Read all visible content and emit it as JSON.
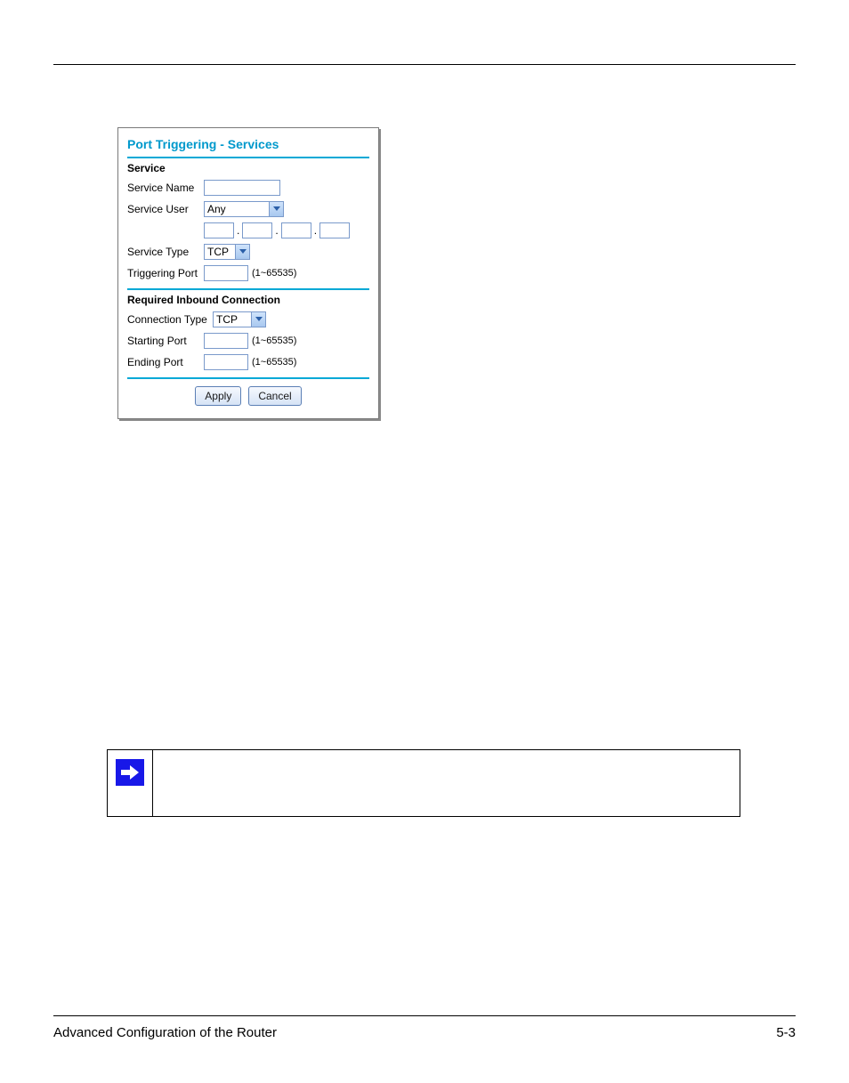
{
  "panel": {
    "title": "Port Triggering - Services",
    "service": {
      "heading": "Service",
      "name_label": "Service Name",
      "name_value": "",
      "user_label": "Service User",
      "user_value": "Any",
      "ip": {
        "o1": "",
        "o2": "",
        "o3": "",
        "o4": ""
      },
      "type_label": "Service Type",
      "type_value": "TCP",
      "trig_label": "Triggering Port",
      "trig_value": "",
      "trig_hint": "(1~65535)"
    },
    "inbound": {
      "heading": "Required Inbound Connection",
      "ctype_label": "Connection Type",
      "ctype_value": "TCP",
      "start_label": "Starting Port",
      "start_value": "",
      "start_hint": "(1~65535)",
      "end_label": "Ending Port",
      "end_value": "",
      "end_hint": "(1~65535)"
    },
    "buttons": {
      "apply": "Apply",
      "cancel": "Cancel"
    }
  },
  "footer": {
    "left": "Advanced Configuration of the Router",
    "right": "5-3"
  }
}
